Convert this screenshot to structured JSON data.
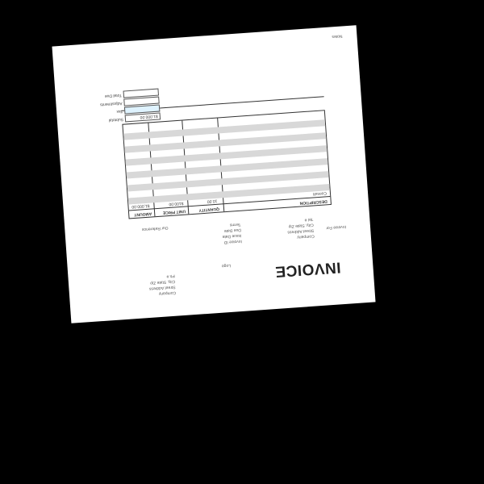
{
  "invoice": {
    "title": "INVOICE",
    "company_block": [
      "Company",
      "Street Address",
      "City, State Zip",
      "Ph #"
    ],
    "logo_text": "Logo",
    "invoice_for_label": "Invoice For",
    "invoice_for": [
      "Company",
      "Street Address",
      "City, State Zip",
      "Tel #"
    ],
    "meta_labels": [
      "Invoice ID",
      "Issue Date",
      "Due Date",
      "Terms"
    ],
    "subject_label": "Our Reference",
    "table_headers": [
      "DESCRIPTION",
      "QUANTITY",
      "UNIT PRICE",
      "AMOUNT"
    ],
    "first_row": {
      "description": "Consult",
      "quantity": "10.00",
      "unit_price": "$100.00",
      "amount": "$1,000.00"
    },
    "totals_labels": [
      "Subtotal",
      "Tax",
      "Adjustments",
      "Total Due"
    ],
    "totals_values": [
      "$1,000.00"
    ],
    "notes_label": "Notes"
  }
}
